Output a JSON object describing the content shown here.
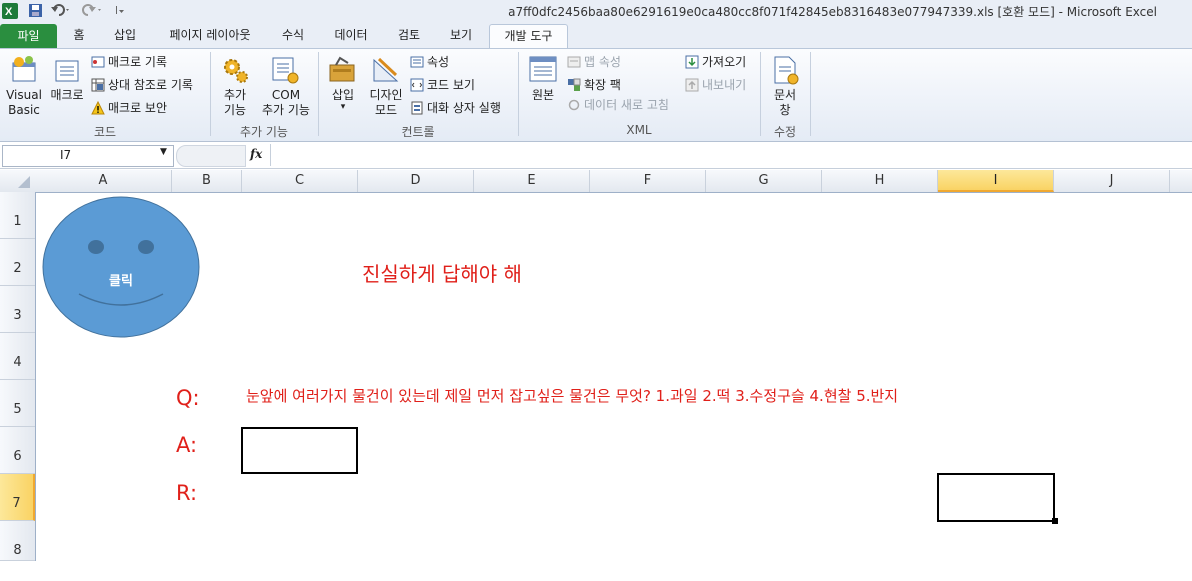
{
  "window": {
    "title": "a7ff0dfc2456baa80e6291619e0ca480cc8f071f42845eb8316483e077947339.xls  [호환 모드]  -  Microsoft Excel"
  },
  "colors": {
    "file_tab": "#2a8e3f",
    "accent_text": "#e0201a",
    "shape_fill": "#5b9bd5",
    "selection": "#f9d364"
  },
  "tabs": [
    "파일",
    "홈",
    "삽입",
    "페이지 레이아웃",
    "수식",
    "데이터",
    "검토",
    "보기",
    "개발 도구"
  ],
  "ribbon": {
    "code": {
      "label": "코드",
      "visual_basic": "Visual\nBasic",
      "macro": "매크로",
      "record_macro": "매크로 기록",
      "relative_ref": "상대 참조로 기록",
      "macro_security": "매크로 보안"
    },
    "addins": {
      "label": "추가 기능",
      "addins": "추가\n기능",
      "com_addins": "COM\n추가 기능"
    },
    "controls": {
      "label": "컨트롤",
      "insert": "삽입",
      "design_mode": "디자인\n모드",
      "properties": "속성",
      "view_code": "코드 보기",
      "run_dialog": "대화 상자 실행"
    },
    "xml": {
      "label": "XML",
      "source": "원본",
      "map_properties": "맵 속성",
      "expansion_packs": "확장 팩",
      "refresh_data": "데이터 새로 고침",
      "import": "가져오기",
      "export": "내보내기"
    },
    "modify": {
      "label": "수정",
      "document_panel": "문서\n창"
    }
  },
  "formula_bar": {
    "name_box": "I7",
    "fx": "fx",
    "value": ""
  },
  "columns": [
    "A",
    "B",
    "C",
    "D",
    "E",
    "F",
    "G",
    "H",
    "I",
    "J"
  ],
  "rows": [
    "1",
    "2",
    "3",
    "4",
    "5",
    "6",
    "7",
    "8"
  ],
  "selected_cell": {
    "column": "I",
    "row": "7"
  },
  "sheet": {
    "smiley_label": "클릭",
    "heading": "진실하게 답해야 해",
    "q_label": "Q:",
    "question": "눈앞에 여러가지 물건이 있는데 제일 먼저 잡고싶은 물건은 무엇? 1.과일 2.떡 3.수정구슬 4.현찰 5.반지",
    "a_label": "A:",
    "r_label": "R:"
  }
}
